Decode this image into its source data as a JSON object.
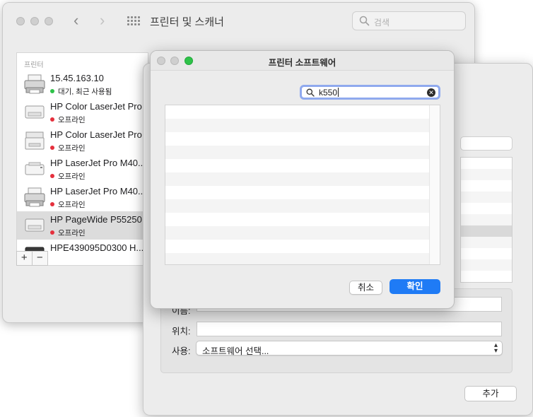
{
  "main_window": {
    "title": "프린터 및 스캐너",
    "search_placeholder": "검색",
    "sidebar": {
      "heading": "프린터",
      "printers": [
        {
          "name": "15.45.163.10",
          "status": "대기, 최근 사용됨",
          "status_color": "#2ec249"
        },
        {
          "name": "HP Color LaserJet Pro",
          "status": "오프라인",
          "status_color": "#e5303d"
        },
        {
          "name": "HP Color LaserJet Pro",
          "status": "오프라인",
          "status_color": "#e5303d"
        },
        {
          "name": "HP LaserJet Pro M40...",
          "status": "오프라인",
          "status_color": "#e5303d"
        },
        {
          "name": "HP LaserJet Pro M40...",
          "status": "오프라인",
          "status_color": "#e5303d"
        },
        {
          "name": "HP PageWide P55250",
          "status": "오프라인",
          "status_color": "#e5303d"
        },
        {
          "name": "HPE439095D0300 H...",
          "status": "",
          "status_color": ""
        }
      ],
      "add_label": "+",
      "remove_label": "−"
    }
  },
  "add_window": {
    "name_label": "이름:",
    "location_label": "위치:",
    "use_label": "사용:",
    "use_value": "소프트웨어 선택...",
    "add_button": "추가"
  },
  "software_sheet": {
    "title": "프린터 소프트웨어",
    "search_value": "k550",
    "cancel_button": "취소",
    "ok_button": "확인",
    "accent_color": "#1f7bf5"
  },
  "icons": {
    "search": "magnifier-icon",
    "back": "chevron-left-icon",
    "forward": "chevron-right-icon",
    "grid": "grid-icon",
    "clear": "clear-search-icon",
    "printer": "printer-icon"
  }
}
